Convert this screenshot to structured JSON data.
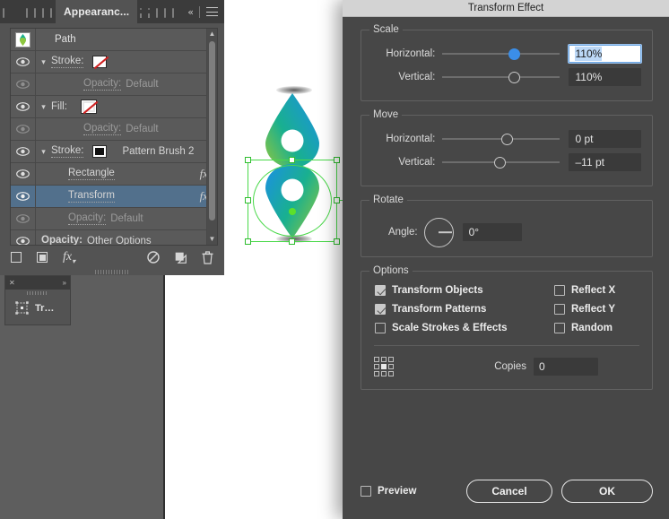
{
  "appearance_panel": {
    "active_tab": "Appearanc...",
    "collapse_icon": "chevron-double-left-icon",
    "menu_icon": "panel-menu-icon",
    "header_row": {
      "label": "Path",
      "thumb": "path-thumbnail-icon"
    },
    "rows": [
      {
        "label": "Stroke:",
        "kind": "stroke",
        "swatch": "none-swatch",
        "extra": "",
        "fx": false,
        "visible": true,
        "dim": false,
        "indent": 1,
        "disclosure": "chevron-down-icon"
      },
      {
        "label": "Opacity:",
        "value": "Default",
        "kind": "opacity",
        "fx": false,
        "visible": false,
        "dim": true,
        "indent": 2
      },
      {
        "label": "Fill:",
        "kind": "fill",
        "swatch": "none-swatch-selected",
        "extra": "",
        "fx": false,
        "visible": true,
        "dim": false,
        "indent": 1,
        "disclosure": "chevron-down-icon"
      },
      {
        "label": "Opacity:",
        "value": "Default",
        "kind": "opacity",
        "fx": false,
        "visible": false,
        "dim": true,
        "indent": 2
      },
      {
        "label": "Stroke:",
        "kind": "stroke-brush",
        "swatch": "black-swatch",
        "extra": "Pattern Brush 2",
        "fx": false,
        "visible": true,
        "dim": false,
        "indent": 1,
        "disclosure": "chevron-down-icon"
      },
      {
        "label": "Rectangle",
        "kind": "effect",
        "fx": true,
        "visible": true,
        "dim": false,
        "indent": 3
      },
      {
        "label": "Transform",
        "kind": "effect",
        "fx": true,
        "visible": true,
        "dim": false,
        "indent": 3,
        "selected": true
      },
      {
        "label": "Opacity:",
        "value": "Default",
        "kind": "opacity",
        "fx": false,
        "visible": false,
        "dim": true,
        "indent": 3
      },
      {
        "label": "Opacity:",
        "value": "Other Options",
        "kind": "opacity",
        "fx": false,
        "visible": true,
        "dim": false,
        "indent": 0
      }
    ],
    "footer_icons": [
      {
        "name": "add-new-stroke-icon"
      },
      {
        "name": "add-new-fill-icon"
      },
      {
        "name": "add-new-effect-icon"
      },
      {
        "name": "clear-appearance-icon"
      },
      {
        "name": "duplicate-selected-item-icon"
      },
      {
        "name": "delete-selected-item-icon"
      }
    ],
    "scrollbar": {
      "up_arrow": "chevron-up-icon",
      "down_arrow": "chevron-down-icon"
    }
  },
  "mini_panel": {
    "close_icon": "close-icon",
    "expand_icon": "chevron-double-right-icon",
    "icon_name": "transform-panel-icon",
    "label": "Tr…"
  },
  "dialog": {
    "title": "Transform Effect",
    "scale": {
      "legend": "Scale",
      "horizontal": {
        "label": "Horizontal:",
        "value": "110%",
        "slider_pct": 56,
        "focused": true,
        "thumb": "filled"
      },
      "vertical": {
        "label": "Vertical:",
        "value": "110%",
        "slider_pct": 56,
        "focused": false,
        "thumb": "hollow"
      }
    },
    "move": {
      "legend": "Move",
      "horizontal": {
        "label": "Horizontal:",
        "value": "0 pt",
        "slider_pct": 50,
        "thumb": "hollow"
      },
      "vertical": {
        "label": "Vertical:",
        "value": "–11 pt",
        "slider_pct": 45,
        "thumb": "hollow"
      }
    },
    "rotate": {
      "legend": "Rotate",
      "angle_label": "Angle:",
      "angle_value": "0°",
      "dial_icon": "angle-dial-icon"
    },
    "options": {
      "legend": "Options",
      "left_column": [
        {
          "label": "Transform Objects",
          "checked": true
        },
        {
          "label": "Transform Patterns",
          "checked": true
        },
        {
          "label": "Scale Strokes & Effects",
          "checked": false
        }
      ],
      "right_column": [
        {
          "label": "Reflect X",
          "checked": false
        },
        {
          "label": "Reflect Y",
          "checked": false
        },
        {
          "label": "Random",
          "checked": false
        }
      ],
      "reference_point_icon": "reference-point-grid-icon",
      "copies_label": "Copies",
      "copies_value": "0"
    },
    "footer": {
      "preview_label": "Preview",
      "preview_checked": false,
      "cancel_label": "Cancel",
      "ok_label": "OK"
    }
  },
  "artwork": {
    "name": "map-pin-artwork",
    "top_shape": "teardrop-gradient-shape",
    "bottom_shape": "map-pin-gradient-shape",
    "selection": "transform-bounding-box",
    "colors": {
      "gradient_green": "#7ac143",
      "gradient_teal": "#14b48c",
      "gradient_blue": "#1b9ad6",
      "selection_green": "#4ad94a",
      "anchor_dot": "#5ce02a"
    }
  },
  "theme": {
    "dialog_bg": "#474747",
    "titlebar_bg": "#d3d3d3",
    "panel_bg": "#535353",
    "row_selected": "#52708c",
    "slider_accent": "#3b8ee8",
    "canvas_bg": "#ffffff"
  }
}
